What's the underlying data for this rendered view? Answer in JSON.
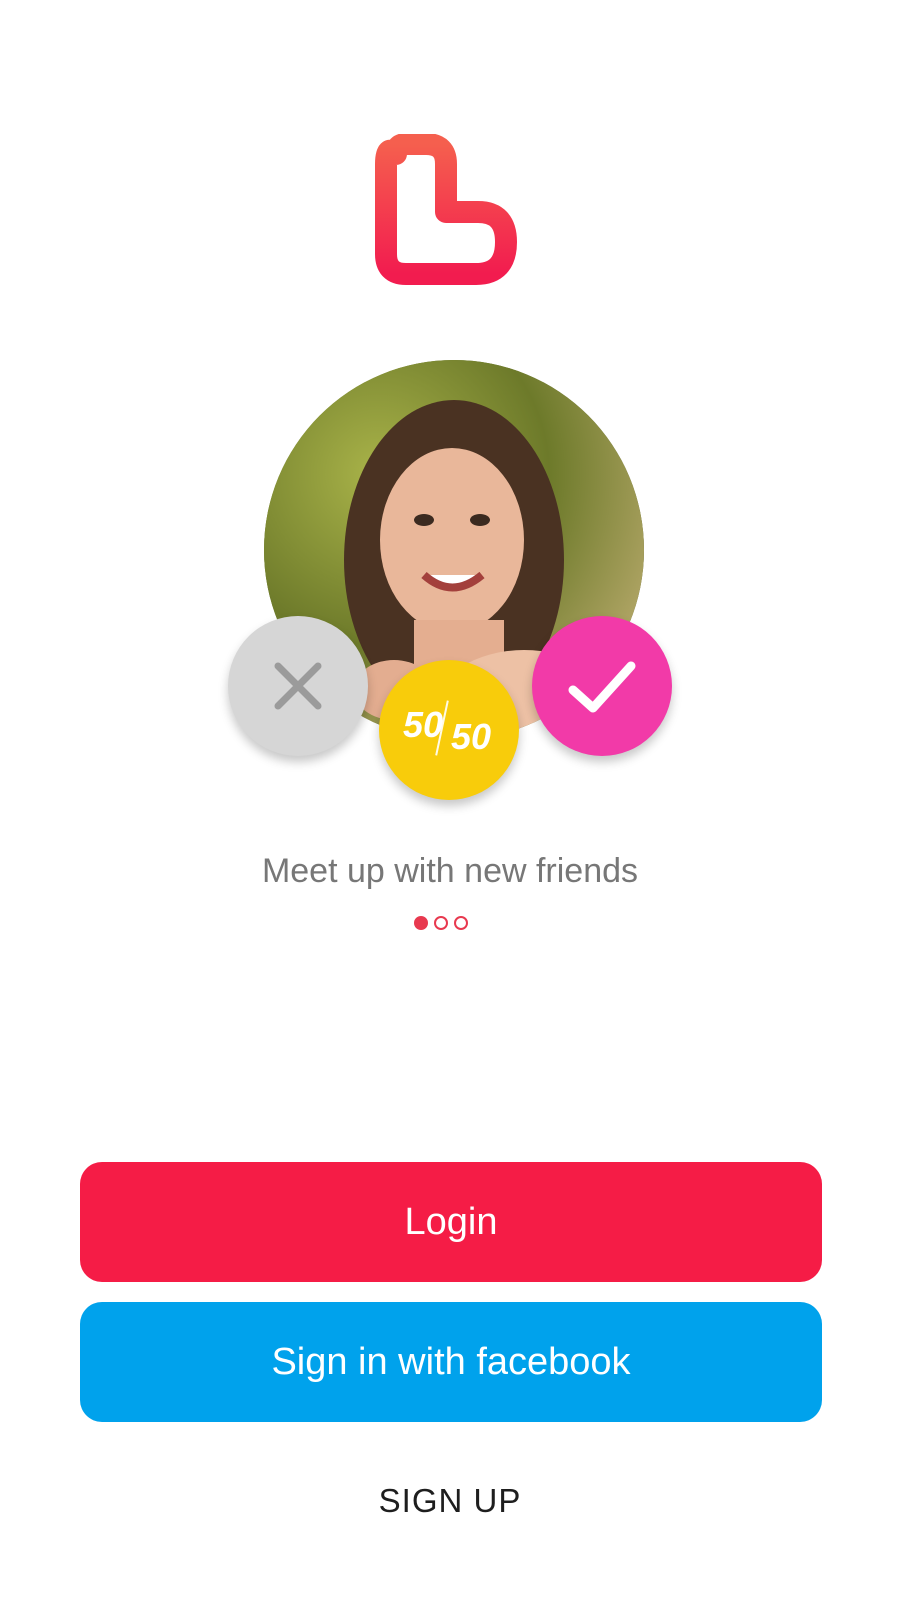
{
  "brand": {
    "logo_icon": "heart-l-logo-icon",
    "gradient_top": "#f55f4e",
    "gradient_bottom": "#f21c4f"
  },
  "hero": {
    "photo_icon": "profile-photo",
    "actions": {
      "nope_icon": "close-icon",
      "like_icon": "checkmark-icon",
      "fifty_left": "50",
      "fifty_right": "50",
      "nope_color": "#d6d6d6",
      "like_color": "#f23aa8",
      "fifty_color": "#f8cc0b"
    }
  },
  "onboarding": {
    "tagline": "Meet up with new friends",
    "page_count": 3,
    "active_page": 1
  },
  "auth": {
    "login_label": "Login",
    "facebook_label": "Sign in with facebook",
    "signup_label": "SIGN UP",
    "login_color": "#f51c46",
    "facebook_color": "#00a2ec"
  }
}
